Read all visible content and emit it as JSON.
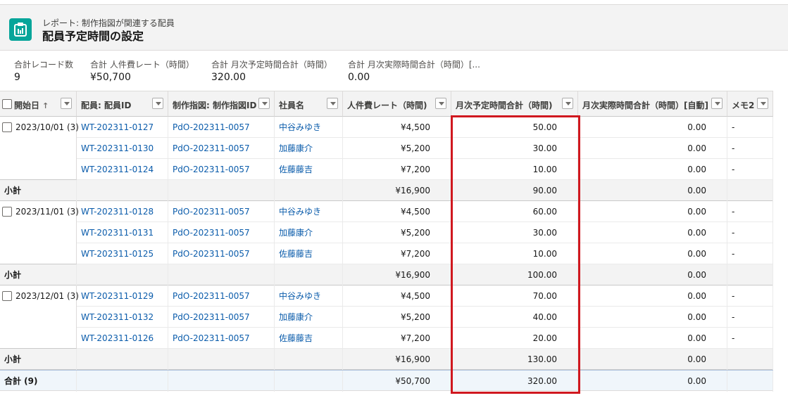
{
  "header": {
    "kicker": "レポート: 制作指図が関連する配員",
    "title": "配員予定時間の設定",
    "icon": "report-icon"
  },
  "summary": [
    {
      "label": "合計レコード数",
      "value": "9"
    },
    {
      "label": "合計 人件費レート（時間）",
      "value": "¥50,700"
    },
    {
      "label": "合計 月次予定時間合計（時間）",
      "value": "320.00"
    },
    {
      "label": "合計 月次実際時間合計（時間）[...",
      "value": "0.00"
    }
  ],
  "columns": [
    {
      "label": "開始日",
      "sort": "↑"
    },
    {
      "label": "配員: 配員ID"
    },
    {
      "label": "制作指図: 制作指図ID"
    },
    {
      "label": "社員名"
    },
    {
      "label": "人件費レート（時間)"
    },
    {
      "label": "月次予定時間合計（時間)"
    },
    {
      "label": "月次実際時間合計（時間）[自動]"
    },
    {
      "label": "メモ2"
    }
  ],
  "groups": [
    {
      "label": "2023/10/01 (3)",
      "rows": [
        {
          "id": "WT-202311-0127",
          "order": "PdO-202311-0057",
          "name": "中谷みゆき",
          "rate": "¥4,500",
          "planned": "50.00",
          "actual": "0.00",
          "memo": "-"
        },
        {
          "id": "WT-202311-0130",
          "order": "PdO-202311-0057",
          "name": "加藤康介",
          "rate": "¥5,200",
          "planned": "30.00",
          "actual": "0.00",
          "memo": "-"
        },
        {
          "id": "WT-202311-0124",
          "order": "PdO-202311-0057",
          "name": "佐藤藤吉",
          "rate": "¥7,200",
          "planned": "10.00",
          "actual": "0.00",
          "memo": "-"
        }
      ],
      "subtotal": {
        "label": "小計",
        "rate": "¥16,900",
        "planned": "90.00",
        "actual": "0.00"
      }
    },
    {
      "label": "2023/11/01 (3)",
      "rows": [
        {
          "id": "WT-202311-0128",
          "order": "PdO-202311-0057",
          "name": "中谷みゆき",
          "rate": "¥4,500",
          "planned": "60.00",
          "actual": "0.00",
          "memo": "-"
        },
        {
          "id": "WT-202311-0131",
          "order": "PdO-202311-0057",
          "name": "加藤康介",
          "rate": "¥5,200",
          "planned": "30.00",
          "actual": "0.00",
          "memo": "-"
        },
        {
          "id": "WT-202311-0125",
          "order": "PdO-202311-0057",
          "name": "佐藤藤吉",
          "rate": "¥7,200",
          "planned": "10.00",
          "actual": "0.00",
          "memo": "-"
        }
      ],
      "subtotal": {
        "label": "小計",
        "rate": "¥16,900",
        "planned": "100.00",
        "actual": "0.00"
      }
    },
    {
      "label": "2023/12/01 (3)",
      "rows": [
        {
          "id": "WT-202311-0129",
          "order": "PdO-202311-0057",
          "name": "中谷みゆき",
          "rate": "¥4,500",
          "planned": "70.00",
          "actual": "0.00",
          "memo": "-"
        },
        {
          "id": "WT-202311-0132",
          "order": "PdO-202311-0057",
          "name": "加藤康介",
          "rate": "¥5,200",
          "planned": "40.00",
          "actual": "0.00",
          "memo": "-"
        },
        {
          "id": "WT-202311-0126",
          "order": "PdO-202311-0057",
          "name": "佐藤藤吉",
          "rate": "¥7,200",
          "planned": "20.00",
          "actual": "0.00",
          "memo": "-"
        }
      ],
      "subtotal": {
        "label": "小計",
        "rate": "¥16,900",
        "planned": "130.00",
        "actual": "0.00"
      }
    }
  ],
  "grand_total": {
    "label": "合計 (9)",
    "rate": "¥50,700",
    "planned": "320.00",
    "actual": "0.00"
  },
  "colors": {
    "accent": "#06a59a",
    "link": "#0b5cab",
    "highlight": "#d0181f"
  }
}
